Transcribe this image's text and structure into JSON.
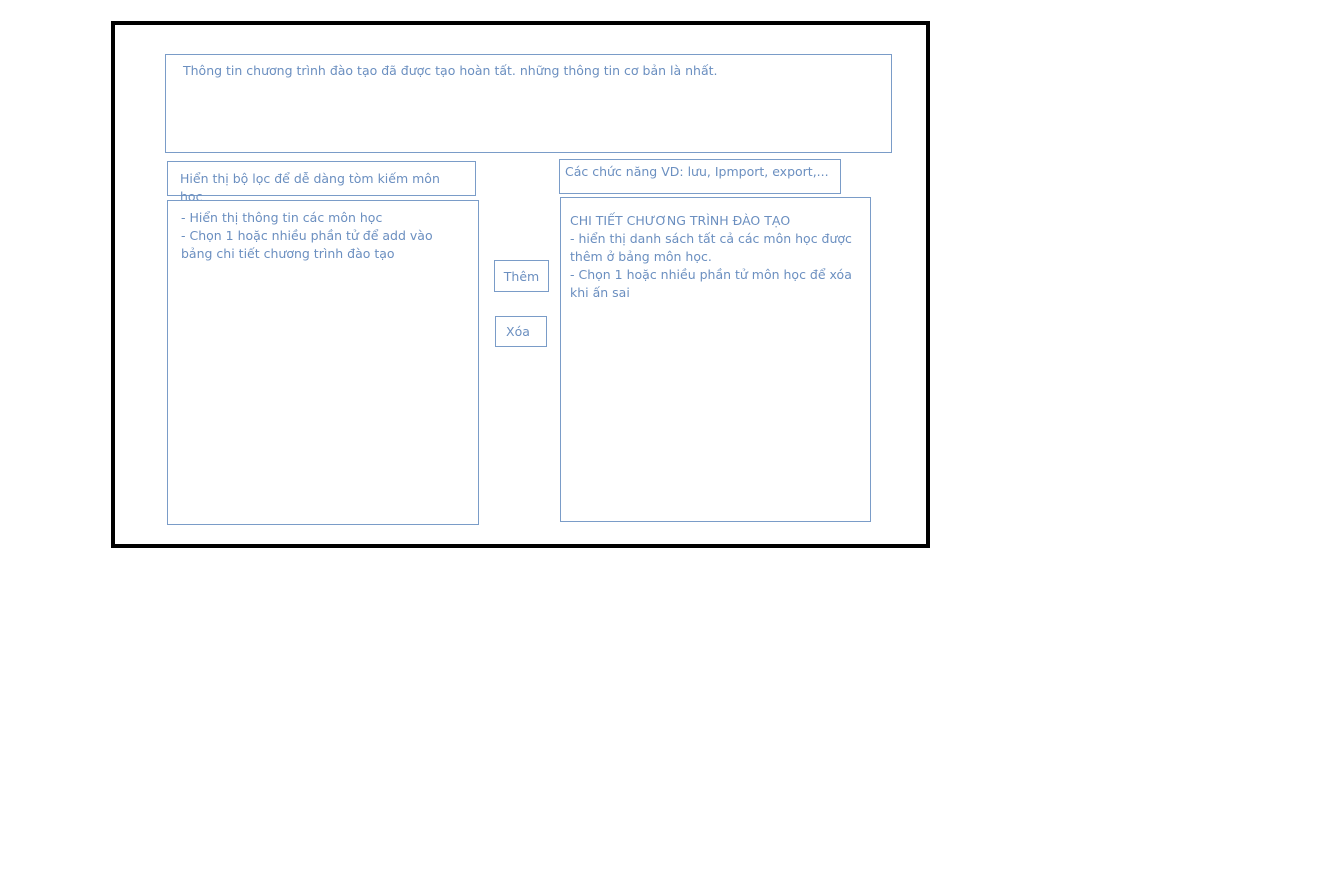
{
  "info_box": {
    "text": "Thông tin chương trình đào tạo đã được tạo hoàn tất. những thông tin cơ bản là nhất."
  },
  "filter_box": {
    "text": "Hiển thị bộ lọc để dễ dàng tòm kiếm môn học"
  },
  "functions_box": {
    "text": "Các chức năng VD: lưu, Ipmport, export,..."
  },
  "subjects_panel": {
    "text": "- Hiển thị thông tin các môn học\n- Chọn 1 hoặc nhiều phần tử để add vào bảng chi tiết chương trình đào tạo"
  },
  "detail_panel": {
    "title": "CHI TIẾT CHƯƠNG TRÌNH ĐÀO TẠO",
    "text": "- hiển thị danh sách tất cả các môn học được thêm ở bảng môn học.\n- Chọn 1 hoặc nhiều phần tử môn học để xóa khi ấn sai"
  },
  "buttons": {
    "add_label": "Thêm",
    "delete_label": "Xóa"
  },
  "colors": {
    "frame_border": "#000000",
    "box_border": "#7a9cc8",
    "text": "#6b8fc0"
  }
}
